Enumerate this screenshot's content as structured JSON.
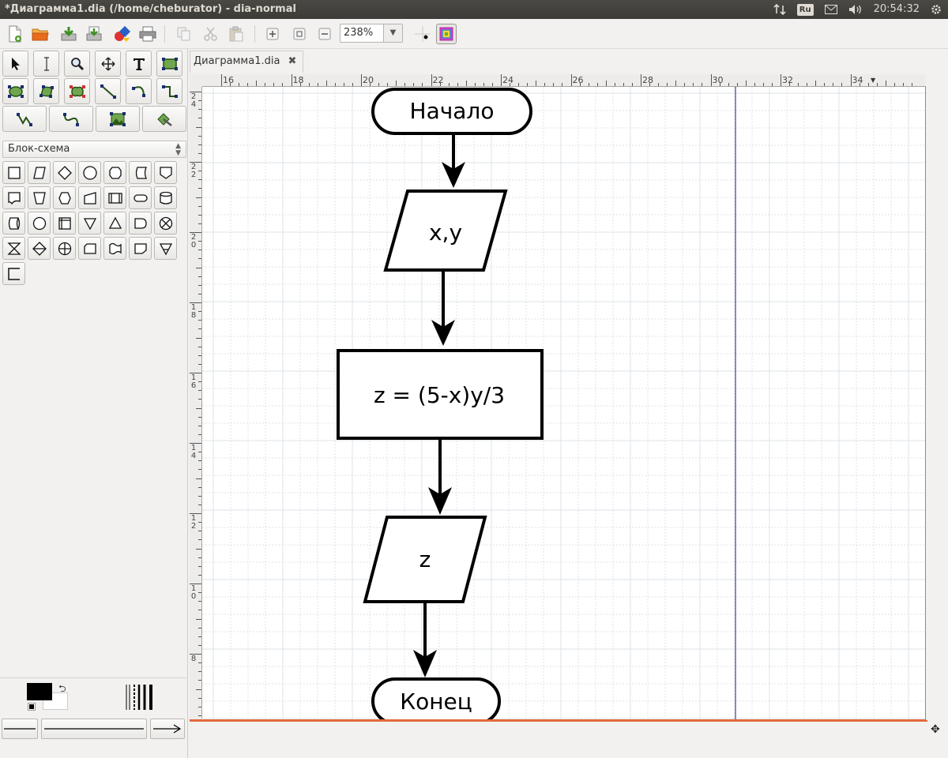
{
  "window": {
    "title": "*Диаграмма1.dia (/home/cheburator) - dia-normal",
    "tray": {
      "lang": "Ru",
      "clock": "20:54:32"
    }
  },
  "toolbar": {
    "zoom_value": "238%",
    "icons": [
      "new-file-icon",
      "open-file-icon",
      "save-icon",
      "save-as-icon",
      "export-icon",
      "print-icon",
      "copy-icon",
      "cut-icon",
      "paste-icon",
      "zoom-in-icon",
      "zoom-fit-icon",
      "zoom-out-icon",
      "snap-grid-icon",
      "object-snap-icon"
    ]
  },
  "tabs": [
    {
      "label": "Диаграмма1.dia",
      "close": "✖"
    }
  ],
  "tools": [
    "pointer-icon",
    "text-cursor-icon",
    "magnify-icon",
    "move-icon",
    "text-tool-icon",
    "box-tool-icon",
    "ellipse-tool-icon",
    "polygon-tool-icon",
    "beziergon-tool-icon",
    "line-tool-icon",
    "arc-tool-icon",
    "zigzag-tool-icon",
    "polyline-tool-icon",
    "bezier-tool-icon",
    "image-tool-icon",
    "outline-tool-icon"
  ],
  "sheet": {
    "selected": "Блок-схема"
  },
  "shapes": [
    "process",
    "data",
    "decision",
    "circle",
    "preparation",
    "stored-data",
    "offpage",
    "document",
    "manual-op",
    "preparation-2",
    "manual-input",
    "predefined",
    "terminal",
    "disk",
    "direct-access",
    "circle-2",
    "internal-storage",
    "merge",
    "extract",
    "delay",
    "or",
    "collate",
    "sort",
    "summing",
    "punched-card",
    "punched-tape",
    "card",
    "offline",
    "annotation"
  ],
  "ruler": {
    "h_labels": [
      "16",
      "18",
      "20",
      "22",
      "24",
      "26",
      "28",
      "30",
      "32",
      "34"
    ],
    "v_labels": [
      "24",
      "22",
      "20",
      "18",
      "16",
      "14",
      "12",
      "10",
      "8"
    ]
  },
  "diagram": {
    "start_label": "Начало",
    "input_label": "x,y",
    "process_label": "z = (5-x)y/3",
    "output_label": "z",
    "end_label": "Конец"
  },
  "colors": {
    "page_edge": "#e2693c",
    "grid": "#dde3ea",
    "guide": "#1c1c7a"
  }
}
